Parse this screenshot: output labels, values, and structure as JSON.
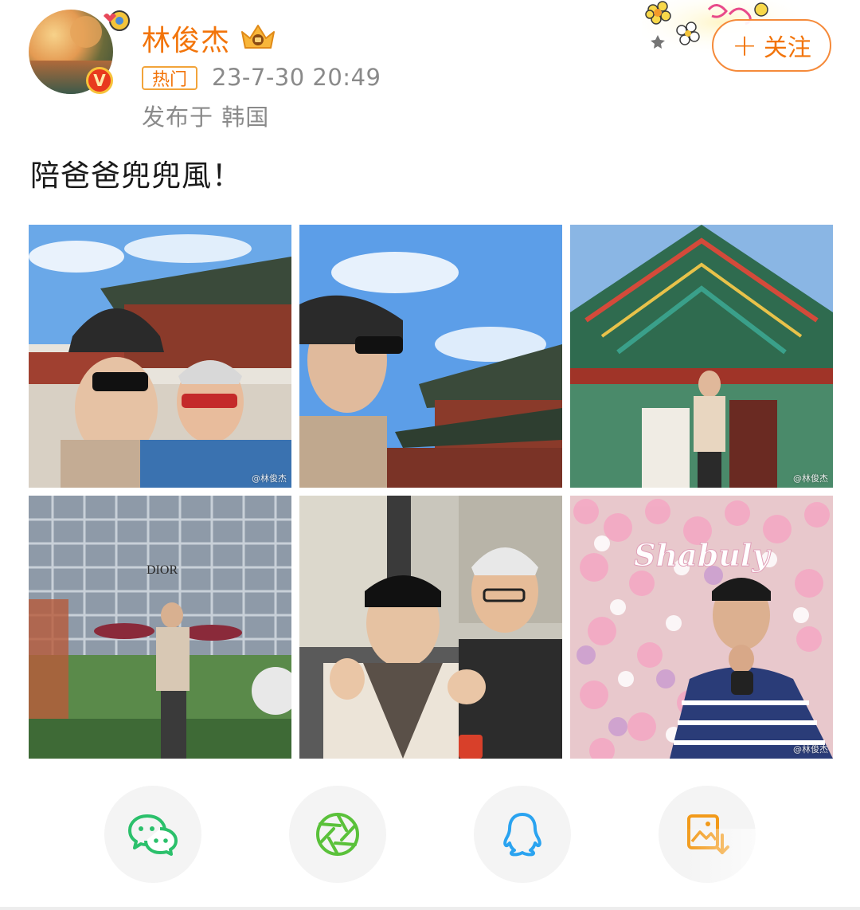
{
  "header": {
    "username": "林俊杰",
    "hot_label": "热门",
    "timestamp": "23-7-30 20:49",
    "location": "发布于 韩国",
    "follow_label": "关注",
    "follow_plus": "+"
  },
  "post": {
    "text": "陪爸爸兜兜風！"
  },
  "photos": [
    {
      "watermark": "@林俊杰",
      "icon": "photo-palace-selfie-with-father"
    },
    {
      "watermark": "",
      "icon": "photo-palace-sky-selfie"
    },
    {
      "watermark": "@林俊杰",
      "icon": "photo-palace-eaves"
    },
    {
      "watermark": "",
      "icon": "photo-dior-building"
    },
    {
      "watermark": "",
      "icon": "photo-restaurant-with-father"
    },
    {
      "watermark": "@林俊杰",
      "icon": "photo-flower-wall"
    }
  ],
  "photo_text": {
    "dior_sign": "DIOR",
    "flower_sign": "Shabuly"
  },
  "share": [
    {
      "icon": "wechat-icon",
      "color": "#2bc06b"
    },
    {
      "icon": "moments-icon",
      "color": "#5ac13a"
    },
    {
      "icon": "qq-icon",
      "color": "#2aa3f0"
    },
    {
      "icon": "save-image-icon",
      "color": "#f29a1a"
    }
  ],
  "colors": {
    "accent": "#f2740a",
    "muted_text": "#8a8a8a"
  }
}
